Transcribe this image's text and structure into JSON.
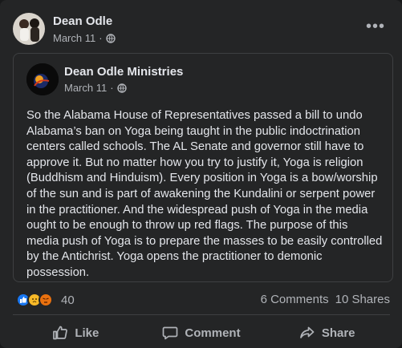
{
  "post": {
    "author": "Dean Odle",
    "date": "March 11",
    "privacy_icon": "globe-icon",
    "menu_label": "•••"
  },
  "shared_post": {
    "author": "Dean Odle Ministries",
    "date": "March 11",
    "privacy_icon": "globe-icon",
    "text": "So the Alabama House of Representatives passed a bill to undo Alabama’s ban on Yoga being taught in the public indoctrination centers called schools. The AL Senate and governor still have to approve it. But no matter how you try to justify it, Yoga is religion (Buddhism and Hinduism). Every position in Yoga is a bow/worship of the sun and is part of awakening the Kundalini or serpent power in the practitioner. And the widespread push of Yoga in the media ought to be enough to throw up red flags. The purpose of this media push of Yoga is to prepare the masses to be easily controlled by the Antichrist. Yoga opens the practitioner to demonic possession."
  },
  "stats": {
    "reactions": [
      "like",
      "sad",
      "angry"
    ],
    "reaction_count": "40",
    "comments": "6 Comments",
    "shares": "10 Shares"
  },
  "actions": {
    "like": "Like",
    "comment": "Comment",
    "share": "Share"
  },
  "colors": {
    "card_bg": "#242526",
    "page_bg": "#18191a",
    "text": "#e4e6eb",
    "secondary": "#b0b3b8",
    "border": "#3e4042",
    "like_blue": "#1877f2",
    "sad_yellow": "#f7b928",
    "angry_orange": "#e9710f"
  }
}
